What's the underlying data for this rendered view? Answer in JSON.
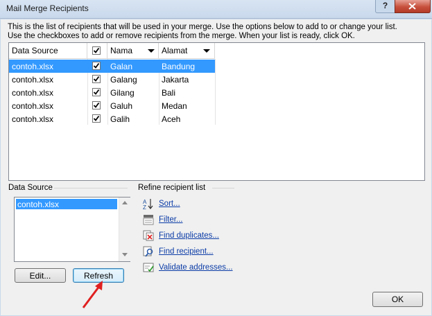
{
  "window": {
    "title": "Mail Merge Recipients",
    "help_label": "?"
  },
  "intro": {
    "line1": "This is the list of recipients that will be used in your merge.  Use the options below to add to or change your list.",
    "line2": "Use the checkboxes to add or remove recipients from the merge.  When your list is ready, click OK."
  },
  "grid": {
    "columns": {
      "source": "Data Source",
      "name": "Nama",
      "address": "Alamat"
    },
    "rows": [
      {
        "source": "contoh.xlsx",
        "name": "Galan",
        "address": "Bandung",
        "checked": true,
        "selected": true
      },
      {
        "source": "contoh.xlsx",
        "name": "Galang",
        "address": "Jakarta",
        "checked": true,
        "selected": false
      },
      {
        "source": "contoh.xlsx",
        "name": "Gilang",
        "address": "Bali",
        "checked": true,
        "selected": false
      },
      {
        "source": "contoh.xlsx",
        "name": "Galuh",
        "address": "Medan",
        "checked": true,
        "selected": false
      },
      {
        "source": "contoh.xlsx",
        "name": "Galih",
        "address": "Aceh",
        "checked": true,
        "selected": false
      }
    ]
  },
  "data_source": {
    "label": "Data Source",
    "items": [
      "contoh.xlsx"
    ],
    "edit_label": "Edit...",
    "refresh_label": "Refresh"
  },
  "refine": {
    "label": "Refine recipient list",
    "sort": "Sort...",
    "filter": "Filter...",
    "duplicates": "Find duplicates...",
    "find": "Find recipient...",
    "validate": "Validate addresses..."
  },
  "footer": {
    "ok_label": "OK"
  },
  "colors": {
    "selection": "#3399ff",
    "link": "#0a3ba6",
    "close_button": "#c7503d",
    "annotation_arrow": "#e02020"
  }
}
